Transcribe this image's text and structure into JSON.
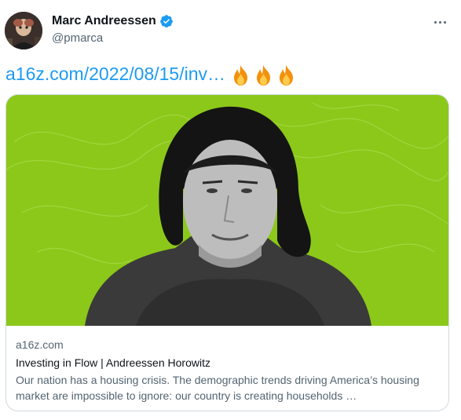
{
  "author": {
    "name": "Marc Andreessen",
    "handle": "@pmarca",
    "verified": true,
    "avatar_icon": "avatar-photo-icon"
  },
  "more_icon": "more-options-icon",
  "tweet": {
    "link_text": "a16z.com/2022/08/15/inv…",
    "emoji": [
      "fire",
      "fire",
      "fire"
    ]
  },
  "card": {
    "domain": "a16z.com",
    "title": "Investing in Flow | Andreessen Horowitz",
    "description": "Our nation has a housing crisis. The demographic trends driving America’s housing market are impossible to ignore: our country is creating households …",
    "image_background": "#8cc81a"
  },
  "colors": {
    "link": "#1d9bf0",
    "secondary_text": "#536471",
    "primary_text": "#0f1419",
    "border": "#cfd9de"
  }
}
